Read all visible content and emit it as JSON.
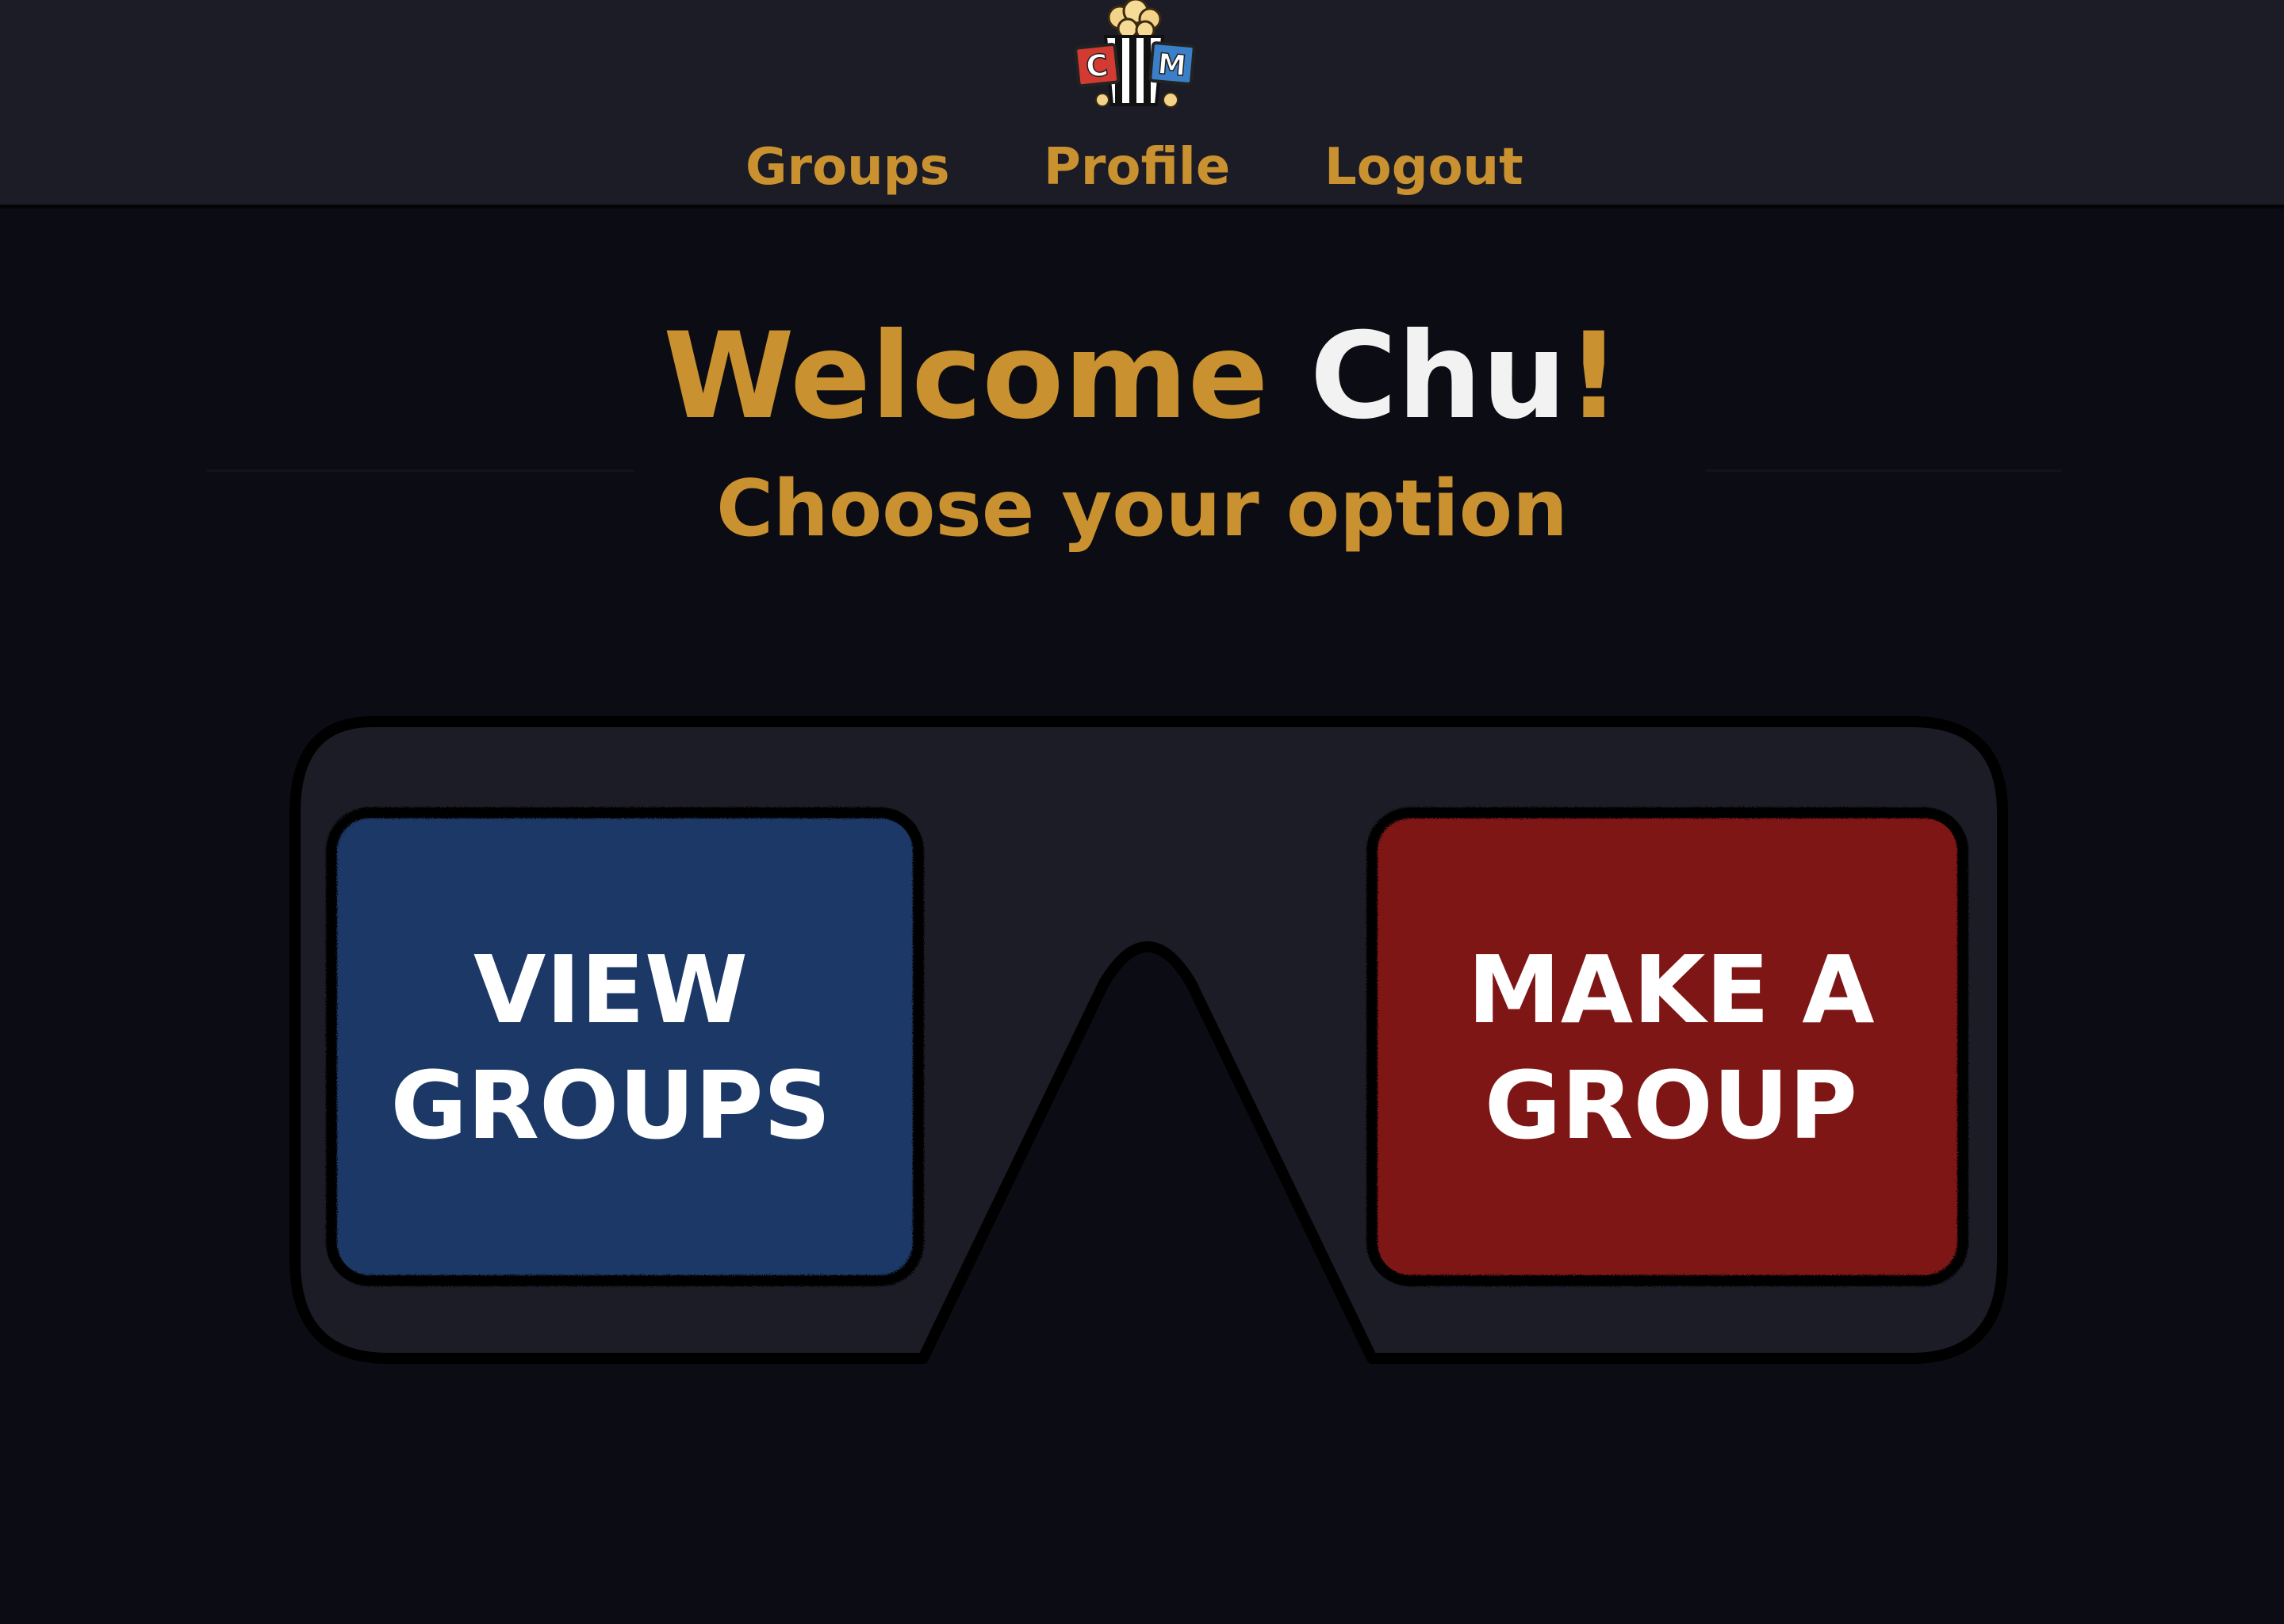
{
  "header": {
    "logo_icon": "popcorn-cm-logo",
    "logo_letters": [
      "C",
      "M"
    ],
    "nav": {
      "groups_label": "Groups",
      "profile_label": "Profile",
      "logout_label": "Logout"
    }
  },
  "main": {
    "welcome_prefix": "Welcome",
    "user_name": "Chu",
    "welcome_suffix": "!",
    "subtitle": "Choose your option",
    "options": {
      "view_groups": {
        "line1": "VIEW",
        "line2": "GROUPS"
      },
      "make_group": {
        "line1": "MAKE A",
        "line2": "GROUP"
      }
    }
  },
  "colors": {
    "accent_gold": "#c9912f",
    "header_bg": "#1b1c25",
    "page_bg": "#0c0d14",
    "lens_blue": "#1c3866",
    "lens_red": "#7f1414",
    "frame": "#1b1c25",
    "text_white": "#f2f2f2"
  }
}
